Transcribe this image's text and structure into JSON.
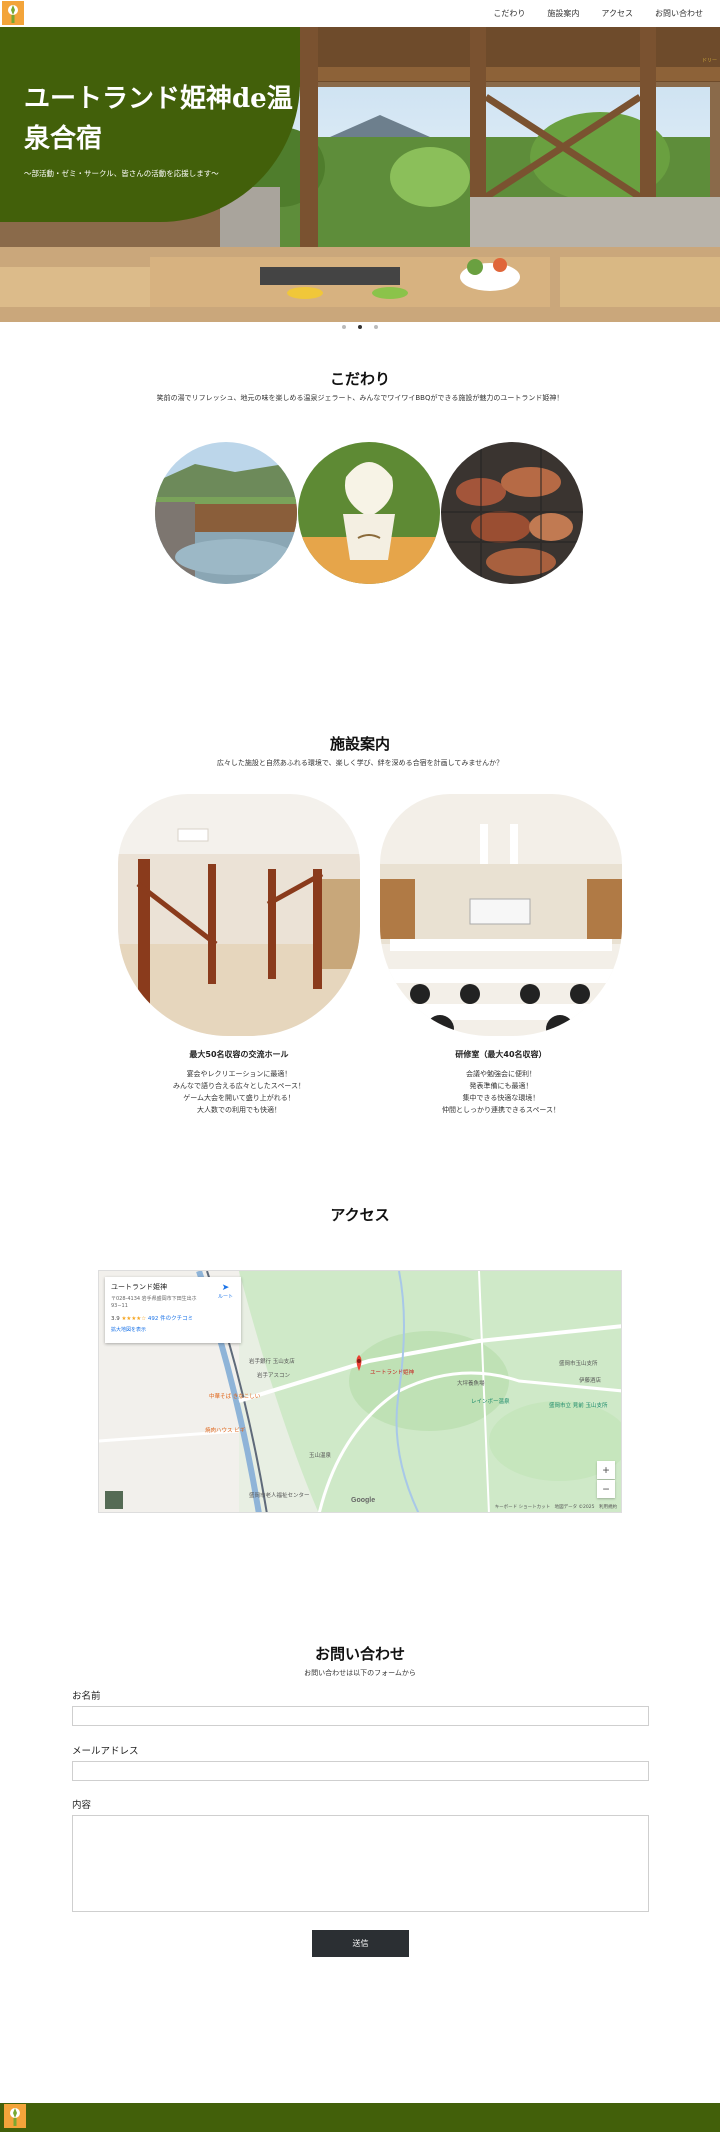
{
  "nav": {
    "items": [
      {
        "label": "こだわり"
      },
      {
        "label": "施設案内"
      },
      {
        "label": "アクセス"
      },
      {
        "label": "お問い合わせ"
      }
    ]
  },
  "hero": {
    "title": "ユートランド姫神de温泉合宿",
    "subtitle": "〜部活動・ゼミ・サークル、皆さんの活動を応援します〜",
    "badge": "ドリー",
    "slides": 3,
    "active_slide": 2
  },
  "kodawari": {
    "title": "こだわり",
    "description": "笑前の湯でリフレッシュ、地元の味を楽しめる温泉ジェラート、みんなでワイワイBBQができる施設が魅力のユートランド姫神！"
  },
  "facilities": {
    "title": "施設案内",
    "description": "広々した施設と自然あふれる環境で、楽しく学び、絆を深める合宿を計画してみませんか？",
    "items": [
      {
        "name": "最大50名収容の交流ホール",
        "desc1": "宴会やレクリエーションに最適！",
        "desc2": "みんなで語り合える広々としたスペース！",
        "desc3": "ゲーム大会を開いて盛り上がれる！",
        "desc4": "大人数での利用でも快適！"
      },
      {
        "name": "研修室（最大40名収容）",
        "desc1": "会議や勉強会に便利！",
        "desc2": "発表準備にも最適！",
        "desc3": "集中できる快適な環境！",
        "desc4": "仲間としっかり連携できるスペース！"
      }
    ]
  },
  "access": {
    "title": "アクセス",
    "map": {
      "place_name": "ユートランド姫神",
      "address": "〒028-4134 岩手県盛岡市下田生出ホ93−11",
      "rating": "3.9",
      "stars": "★★★★☆",
      "reviews": "492 件のクチコミ",
      "larger_map": "拡大地図を表示",
      "route": "ルート",
      "pin_label": "ユートランド姫神",
      "labels": {
        "l1": "岩手アスコン",
        "l2": "中華そば きなこしい",
        "l3": "焼肉ハウス ビギ",
        "l4": "玉山温泉",
        "l5": "大坪養魚場",
        "l6": "レインボー温泉",
        "l7": "盛岡市玉山支所",
        "l8": "盛岡市立 見前 玉山支所",
        "l9": "伊藤酒店",
        "l10": "盛岡市老人福祉センター",
        "l11": "岩手銀行 玉山支店"
      },
      "zoom_in": "+",
      "zoom_out": "−",
      "google": "Google",
      "footer": "キーボード ショートカット　地図データ ©2025　利用規約"
    }
  },
  "contact": {
    "title": "お問い合わせ",
    "description": "お問い合わせは以下のフォームから",
    "name_label": "お名前",
    "email_label": "メールアドレス",
    "content_label": "内容",
    "submit_label": "送信"
  },
  "colors": {
    "brand_green": "#42600a",
    "button_dark": "#2b2f33"
  }
}
